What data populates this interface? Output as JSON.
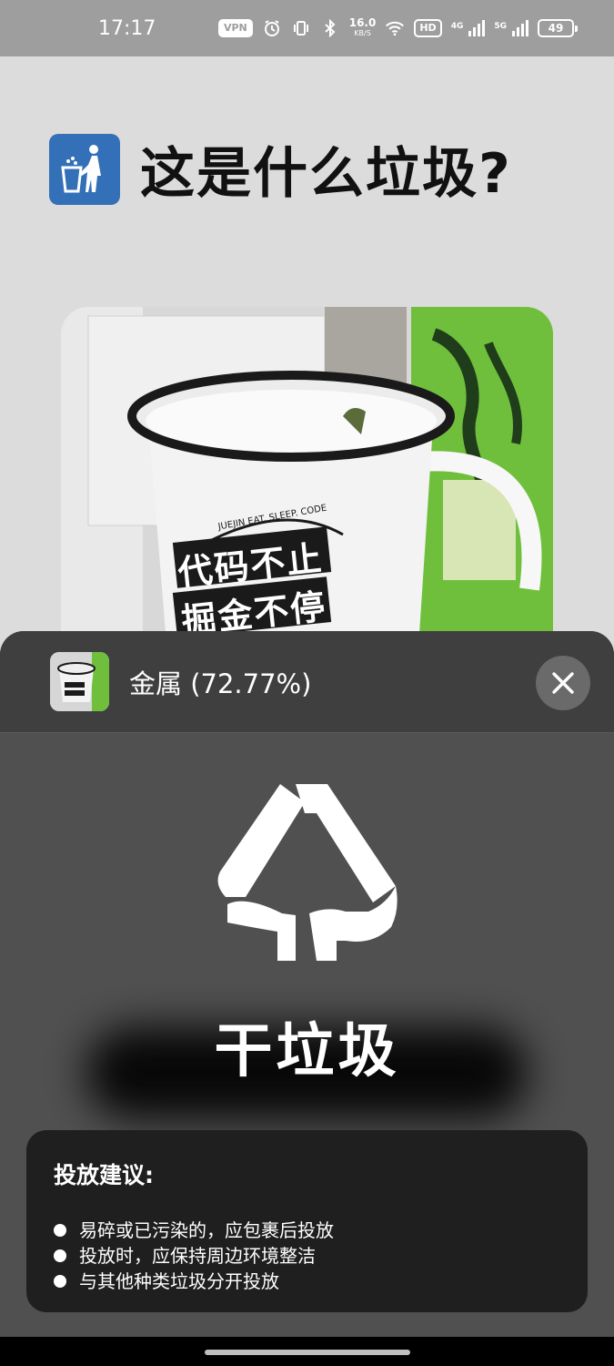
{
  "status_bar": {
    "time": "17:17",
    "vpn": "VPN",
    "speed_value": "16.0",
    "speed_unit": "KB/S",
    "hd": "HD",
    "net1": "4G",
    "net2": "5G",
    "battery": "49"
  },
  "header": {
    "icon": "trash-can-icon",
    "title": "这是什么垃圾?"
  },
  "photo": {
    "mug_text_line1": "代码不止",
    "mug_text_line2": "掘金不停",
    "mug_arc_text": "JUEJIN EAT. SLEEP. CODE"
  },
  "result_sheet": {
    "label": "金属 (72.77%)",
    "close_icon": "close-icon",
    "category_icon": "dry-waste-icon",
    "category": "干垃圾",
    "advice_title": "投放建议:",
    "advice_items": [
      "易碎或已污染的，应包裹后投放",
      "投放时，应保持周边环境整洁",
      "与其他种类垃圾分开投放"
    ]
  },
  "colors": {
    "sheet_bg": "#505050",
    "sheet_header_bg": "#3f3f3f",
    "advice_bg": "#1f1f1f",
    "icon_blue": "#3470b8"
  }
}
